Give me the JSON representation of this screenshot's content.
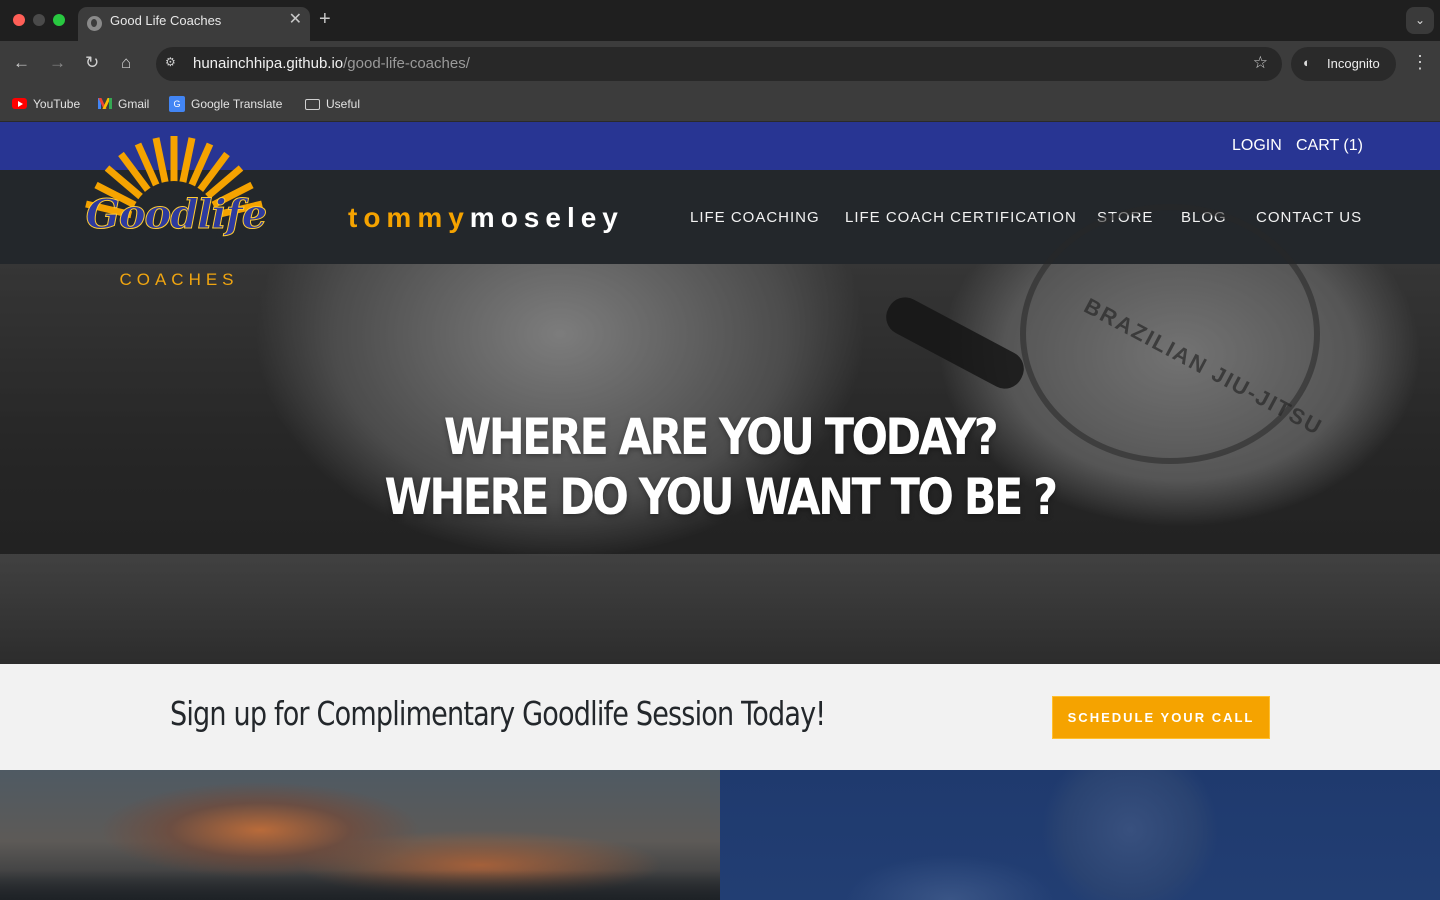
{
  "browser": {
    "tab_title": "Good Life Coaches",
    "url_host": "hunainchhipa.github.io",
    "url_path": "/good-life-coaches/",
    "profile_label": "Incognito",
    "bookmarks": [
      {
        "label": "YouTube",
        "icon": "youtube-icon"
      },
      {
        "label": "Gmail",
        "icon": "gmail-icon"
      },
      {
        "label": "Google Translate",
        "icon": "google-translate-icon"
      },
      {
        "label": "Useful",
        "icon": "folder-icon"
      }
    ]
  },
  "site": {
    "topbar": {
      "login": "LOGIN",
      "cart": "CART (1)"
    },
    "logo": {
      "word": "Goodlife",
      "sub": "COACHES"
    },
    "brand": {
      "first": "tommy",
      "last": "moseley"
    },
    "nav": [
      "LIFE COACHING",
      "LIFE COACH CERTIFICATION",
      "STORE",
      "BLOG",
      "CONTACT US"
    ],
    "hero": {
      "line1": "WHERE ARE YOU TODAY?",
      "line2": "WHERE DO YOU WANT TO BE ?",
      "seal_text": "BRAZILIAN JIU-JITSU"
    },
    "signup": {
      "text": "Sign up for Complimentary Goodlife Session Today!",
      "cta": "SCHEDULE YOUR CALL"
    }
  },
  "colors": {
    "topbar": "#283593",
    "nav_bg": "#23272b",
    "accent": "#f5a300",
    "signup_bg": "#f2f2f2"
  }
}
